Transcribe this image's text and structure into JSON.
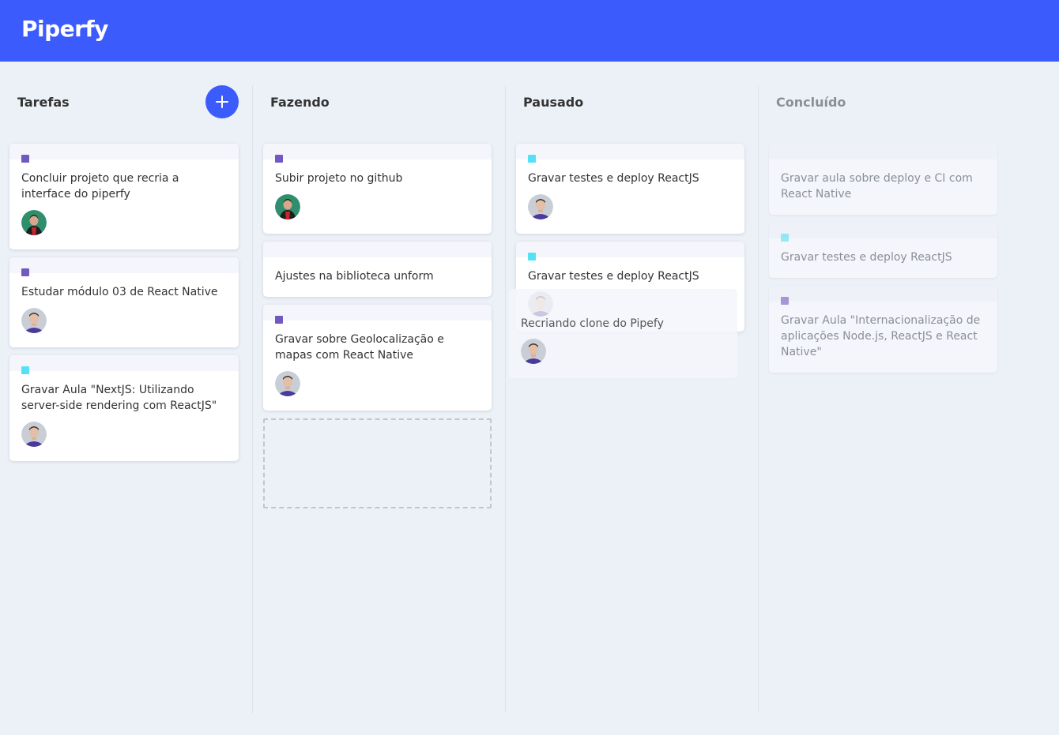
{
  "app": {
    "logo": "Piperfy"
  },
  "colors": {
    "primary": "#3b5bfd",
    "purple": "#7159c1",
    "cyan": "#54e1f5",
    "background": "#ecf1f8"
  },
  "lists": [
    {
      "title": "Tarefas",
      "add_button_icon": "plus-icon",
      "cards": [
        {
          "text": "Concluir projeto que recria a interface do piperfy",
          "label_color": "#7159c1",
          "avatar": "user-avatar-red"
        },
        {
          "text": "Estudar módulo 03 de React Native",
          "label_color": "#7159c1",
          "avatar": "user-avatar-purple"
        },
        {
          "text": "Gravar Aula \"NextJS: Utilizando server-side rendering com ReactJS\"",
          "label_color": "#54e1f5",
          "avatar": "user-avatar-purple"
        }
      ]
    },
    {
      "title": "Fazendo",
      "cards": [
        {
          "text": "Subir projeto no github",
          "label_color": "#7159c1",
          "avatar": "user-avatar-red"
        },
        {
          "text": "Ajustes na biblioteca unform"
        },
        {
          "text": "Gravar sobre Geolocalização e mapas com React Native",
          "label_color": "#7159c1",
          "avatar": "user-avatar-purple"
        }
      ]
    },
    {
      "title": "Pausado",
      "cards": [
        {
          "text": "Gravar testes e deploy ReactJS",
          "label_color": "#54e1f5",
          "avatar": "user-avatar-purple"
        },
        {
          "text": "Gravar testes e deploy ReactJS",
          "label_color": "#54e1f5"
        }
      ],
      "dragging_card": {
        "text": "Recriando clone do Pipefy",
        "avatar": "user-avatar-purple"
      }
    },
    {
      "title": "Concluído",
      "cards": [
        {
          "text": "Gravar aula sobre deploy e CI com React Native"
        },
        {
          "text": "Gravar testes e deploy ReactJS",
          "label_color": "#54e1f5"
        },
        {
          "text": "Gravar Aula \"Internacionalização de aplicações Node.js, ReactJS e React Native\"",
          "label_color": "#7159c1"
        }
      ]
    }
  ]
}
